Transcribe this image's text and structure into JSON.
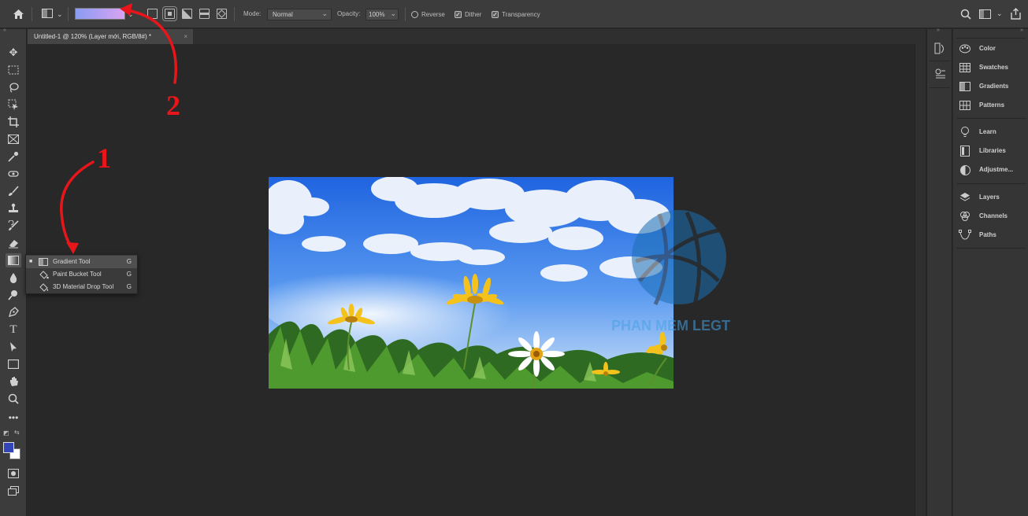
{
  "options_bar": {
    "home_icon": "home-icon",
    "tool_preset_icon": "gradient-tool-preset-icon",
    "gradient_colors": [
      "#8a9cf2",
      "#d9a3f2"
    ],
    "mode_label": "Mode:",
    "mode_value": "Normal",
    "opacity_label": "Opacity:",
    "opacity_value": "100%",
    "reverse_label": "Reverse",
    "dither_label": "Dither",
    "transparency_label": "Transparency",
    "reverse_checked": false,
    "dither_checked": true,
    "transparency_checked": true
  },
  "document": {
    "tab_title": "Untitled-1 @ 120% (Layer mới, RGB/8#) *",
    "close_glyph": "×"
  },
  "toolbar": {
    "tools": [
      "move",
      "marquee",
      "lasso",
      "object-selection",
      "crop",
      "frame",
      "eyedropper",
      "spot-healing",
      "brush",
      "clone-stamp",
      "history-brush",
      "eraser",
      "gradient",
      "blur",
      "dodge",
      "pen",
      "type",
      "path-selection",
      "rectangle",
      "hand",
      "zoom",
      "more"
    ],
    "foreground_color": "#3346b9",
    "background_color": "#ffffff"
  },
  "flyout": {
    "items": [
      {
        "label": "Gradient Tool",
        "key": "G",
        "icon": "gradient-icon",
        "selected": true
      },
      {
        "label": "Paint Bucket Tool",
        "key": "G",
        "icon": "paint-bucket-icon",
        "selected": false
      },
      {
        "label": "3D Material Drop Tool",
        "key": "G",
        "icon": "material-drop-icon",
        "selected": false
      }
    ]
  },
  "panels": {
    "group1": [
      "Color",
      "Swatches",
      "Gradients",
      "Patterns"
    ],
    "group2": [
      "Learn",
      "Libraries",
      "Adjustme..."
    ],
    "group3": [
      "Layers",
      "Channels",
      "Paths"
    ]
  },
  "annotations": {
    "label1": "1",
    "label2": "2",
    "color": "#e8161b"
  },
  "watermark": {
    "text": "PHAN MÈM LEGT"
  }
}
